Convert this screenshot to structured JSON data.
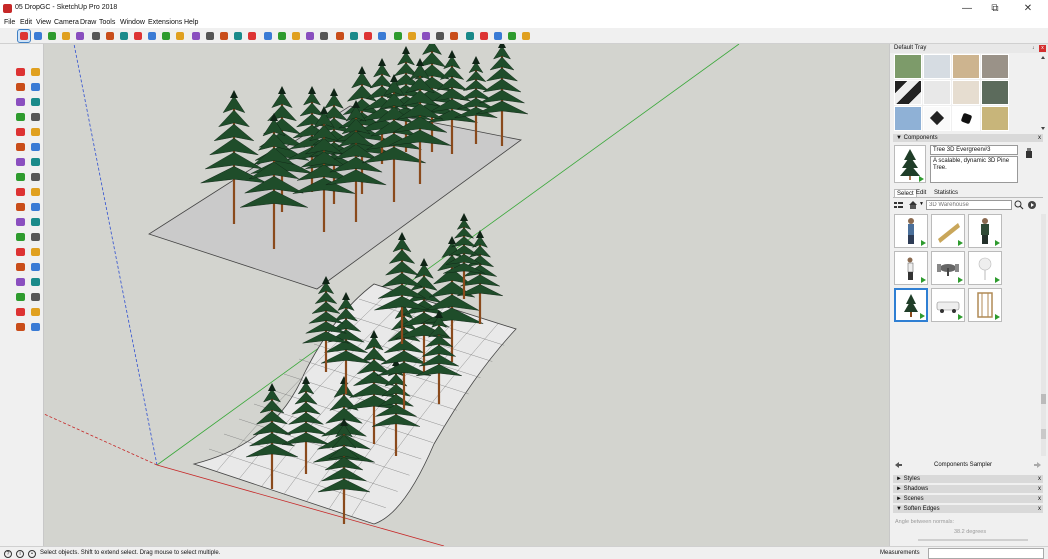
{
  "window": {
    "title": "05 DropGC - SketchUp Pro 2018",
    "controls": {
      "minimize": "—",
      "maximize": "⧉",
      "close": "✕"
    }
  },
  "menu": [
    "File",
    "Edit",
    "View",
    "Camera",
    "Draw",
    "Tools",
    "Window",
    "Extensions",
    "Help"
  ],
  "toolbar": {
    "icons": [
      "select-icon",
      "eraser-icon",
      "pencil-icon",
      "shapes-icon",
      "push-pull-icon",
      "move-icon",
      "rotate-icon",
      "scale-icon",
      "offset-icon",
      "follow-me-icon",
      "tape-icon",
      "protractor-icon",
      "text-icon",
      "axes-icon",
      "dimension-icon",
      "paint-icon",
      "orbit-icon",
      "pan-icon",
      "zoom-icon",
      "zoom-extents-icon",
      "zoom-window-icon",
      "previous-view-icon",
      "section-plane-icon",
      "x-ray-icon",
      "back-edges-icon",
      "wireframe-icon",
      "hidden-line-icon",
      "shaded-icon",
      "shaded-textures-icon",
      "monochrome-icon",
      "iso-view-icon",
      "top-view-icon",
      "front-view-icon",
      "right-view-icon",
      "back-view-icon",
      "left-view-icon"
    ]
  },
  "left_toolbar": {
    "icons": [
      "select-icon",
      "eraser-icon",
      "paint-bucket-icon",
      "lasso-icon",
      "line-icon",
      "freehand-icon",
      "rectangle-icon",
      "rotated-rectangle-icon",
      "circle-icon",
      "polygon-icon",
      "arc-icon",
      "pie-icon",
      "three-point-arc-icon",
      "two-point-arc-icon",
      "move-icon",
      "push-pull-icon",
      "rotate-icon",
      "follow-me-icon",
      "scale-icon",
      "offset-icon",
      "tape-measure-icon",
      "dimension-icon",
      "protractor-icon",
      "text-icon",
      "axes-icon",
      "3d-text-icon",
      "orbit-icon",
      "pan-icon",
      "zoom-icon",
      "zoom-window-icon",
      "zoom-extents-icon",
      "previous-icon",
      "position-camera-icon",
      "look-around-icon",
      "walk-icon",
      "section-plane-icon"
    ]
  },
  "tray": {
    "title": "Default Tray",
    "pin": "↓",
    "close": "x",
    "components": {
      "header": "▼ Components",
      "close": "x",
      "name": "Tree 3D Evergreen#3",
      "description": "A scalable, dynamic 3D Pine Tree.",
      "tabs": [
        "Select",
        "Edit",
        "Statistics"
      ],
      "search_placeholder": "3D Warehouse",
      "sampler_label": "Components Sampler"
    },
    "panels": [
      {
        "label": "► Styles",
        "close": "x"
      },
      {
        "label": "► Shadows",
        "close": "x"
      },
      {
        "label": "► Scenes",
        "close": "x"
      },
      {
        "label": "▼ Soften Edges",
        "close": "x"
      }
    ],
    "soften_edges": {
      "label": "Angle between normals:",
      "value": "38.2  degrees"
    }
  },
  "status": {
    "text": "Select objects. Shift to extend select. Drag mouse to select multiple.",
    "measurements_label": "Measurements"
  },
  "colors": {
    "viewport_bg": "#d3d4cf",
    "axis_red": "#c62828",
    "axis_green": "#3aa83a",
    "axis_blue": "#3050d0",
    "tree_green": "#1f4d2a",
    "trunk_brown": "#8a4a1c",
    "selection_blue": "#2f7fd3"
  }
}
